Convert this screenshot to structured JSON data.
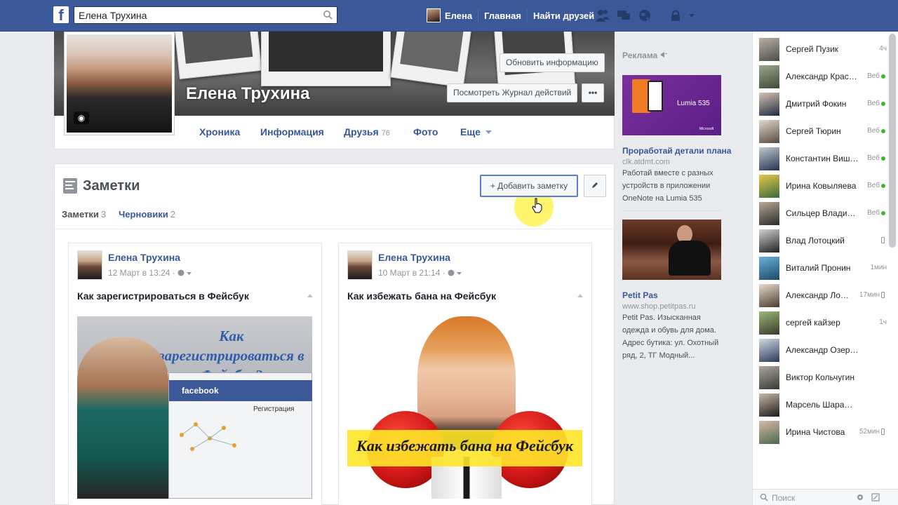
{
  "topbar": {
    "logo": "f",
    "search_value": "Елена Трухина",
    "user_name": "Елена",
    "home": "Главная",
    "find_friends": "Найти друзей"
  },
  "profile": {
    "name": "Елена Трухина",
    "update_info": "Обновить информацию",
    "activity_log": "Посмотреть Журнал действий",
    "more": "•••",
    "tabs": [
      {
        "label": "Хроника",
        "count": ""
      },
      {
        "label": "Информация",
        "count": ""
      },
      {
        "label": "Друзья",
        "count": "76"
      },
      {
        "label": "Фото",
        "count": ""
      },
      {
        "label": "Еще",
        "count": ""
      }
    ]
  },
  "notes": {
    "title": "Заметки",
    "add_note": "+ Добавить заметку",
    "subtabs": [
      {
        "label": "Заметки",
        "count": "3"
      },
      {
        "label": "Черновики",
        "count": "2"
      }
    ],
    "cards": [
      {
        "author": "Елена Трухина",
        "date": "12 Март в 13:24",
        "title": "Как зарегистрироваться в Фейсбук",
        "image_text": "Как зарегистрироваться в Фейсбук?",
        "image_fb_label": "facebook",
        "image_reg_label": "Регистрация"
      },
      {
        "author": "Елена Трухина",
        "date": "10 Март в 21:14",
        "title": "Как избежать бана на Фейсбук",
        "image_text": "Как избежать бана на Фейсбук"
      }
    ]
  },
  "ads": {
    "title": "Реклама",
    "items": [
      {
        "image_label": "Lumia 535",
        "image_brand": "Microsoft",
        "headline": "Проработай детали плана",
        "url": "clk.atdmt.com",
        "body": "Работай вместе с разных устройств в приложении OneNote на Lumia 535"
      },
      {
        "headline": "Petit Pas",
        "url": "www.shop.petitpas.ru",
        "body": "Petit Pas. Изысканная одежда и обувь для дома. Адрес бутика: ул. Охотный ряд, 2, ТГ Модный..."
      }
    ]
  },
  "chat": {
    "search_placeholder": "Поиск",
    "friends": [
      {
        "name": "Сергей Пузик",
        "status": "4ч",
        "indicator": "none"
      },
      {
        "name": "Александр Красу…",
        "status": "Веб",
        "indicator": "online"
      },
      {
        "name": "Дмитрий Фокин",
        "status": "Веб",
        "indicator": "online"
      },
      {
        "name": "Сергей Тюрин",
        "status": "Веб",
        "indicator": "online"
      },
      {
        "name": "Константин Вишн…",
        "status": "Веб",
        "indicator": "online"
      },
      {
        "name": "Ирина Ковыляева",
        "status": "Веб",
        "indicator": "online"
      },
      {
        "name": "Сильцер Владимир",
        "status": "Веб",
        "indicator": "online"
      },
      {
        "name": "Влад Лотоцкий",
        "status": "",
        "indicator": "mobile"
      },
      {
        "name": "Виталий Пронин",
        "status": "1мин",
        "indicator": "none"
      },
      {
        "name": "Александр Ло…",
        "status": "17мин",
        "indicator": "mobile"
      },
      {
        "name": "сергей кайзер",
        "status": "1ч",
        "indicator": "none"
      },
      {
        "name": "Александр Озеров",
        "status": "",
        "indicator": "none"
      },
      {
        "name": "Виктор Кольчугин",
        "status": "",
        "indicator": "none"
      },
      {
        "name": "Марсель Шарафиев",
        "status": "",
        "indicator": "none"
      },
      {
        "name": "Ирина Чистова",
        "status": "52мин",
        "indicator": "mobile"
      }
    ]
  }
}
